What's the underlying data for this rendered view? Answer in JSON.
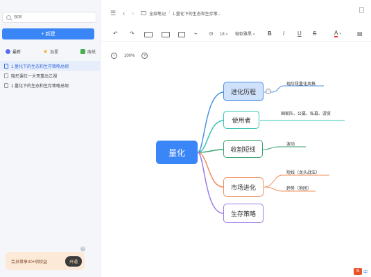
{
  "sidebar": {
    "search_placeholder": "搜索",
    "new_button": "+ 新建",
    "tabs": [
      {
        "label": "最新",
        "icon": "clock-icon"
      },
      {
        "label": "加星",
        "icon": "star-icon"
      },
      {
        "label": "废纸",
        "icon": "trash-icon"
      }
    ],
    "docs": [
      {
        "title": "1.量化下的生态和生存策略总纲"
      },
      {
        "title": "隐形课位一大哥重出江湖"
      },
      {
        "title": "1.量化下的生态和生存策略总纲"
      }
    ],
    "promo": {
      "text": "会员尊享40+项权益",
      "button": "开通"
    }
  },
  "topnav": {
    "breadcrumb_root": "全部笔记",
    "breadcrumb_current": "1.量化下的生态和生存策..."
  },
  "toolbar": {
    "font_size": "18",
    "font_family": "微软雅黑",
    "bold": "B",
    "italic": "I",
    "underline": "U",
    "strike": "S",
    "color": "A"
  },
  "zoom": {
    "level": "100%"
  },
  "mindmap": {
    "root": "量化",
    "branches": [
      {
        "label": "进化历程",
        "leaves": [
          "现阶段量化风格"
        ]
      },
      {
        "label": "使用者",
        "leaves": [
          "国家队、公募、私募、游资"
        ]
      },
      {
        "label": "收割短线",
        "leaves": [
          "波动"
        ]
      },
      {
        "label": "市场进化",
        "leaves": [
          "短线（龙头战法）",
          "趋势（抱团）"
        ]
      },
      {
        "label": "生存策略",
        "leaves": []
      }
    ]
  },
  "ime": {
    "brand": "S",
    "mode": "中"
  }
}
